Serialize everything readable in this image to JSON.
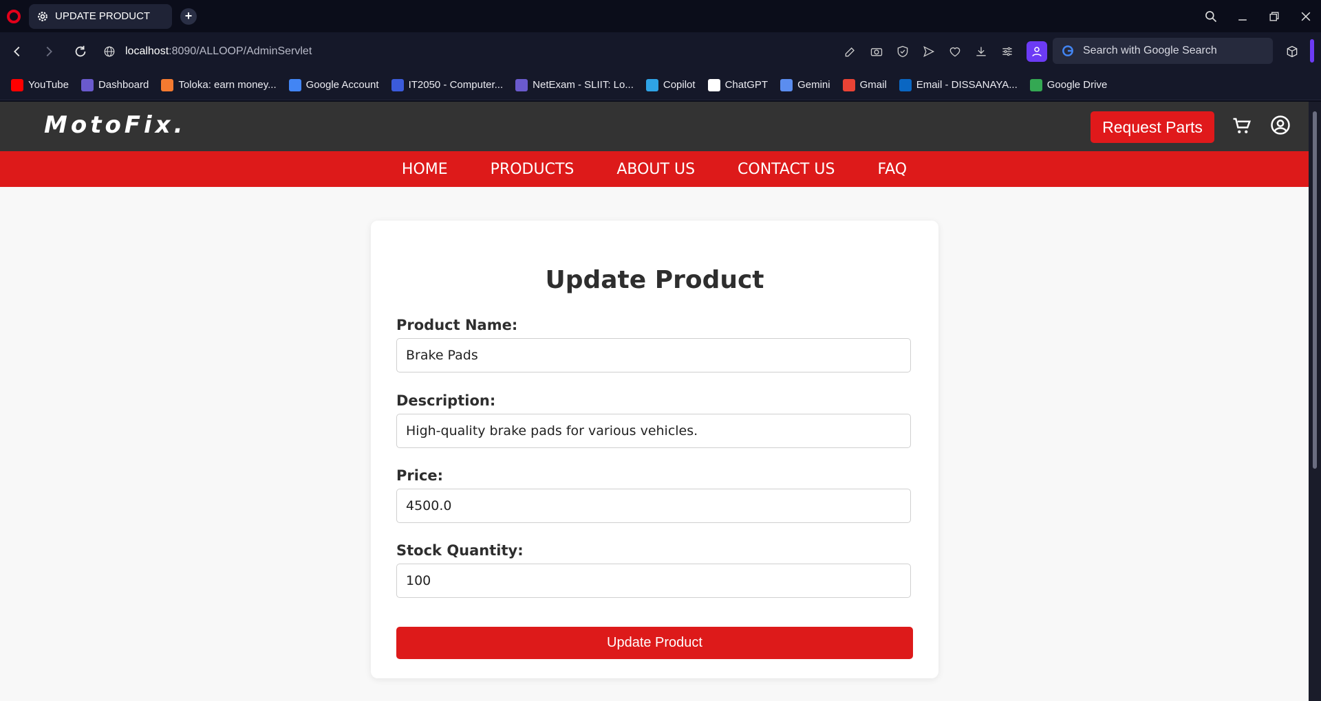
{
  "browser": {
    "tab_title": "UPDATE PRODUCT",
    "url_host": "localhost",
    "url_path": ":8090/ALLOOP/AdminServlet",
    "search_placeholder": "Search with Google Search",
    "bookmarks": [
      {
        "label": "YouTube",
        "color": "#ff0000"
      },
      {
        "label": "Dashboard",
        "color": "#6a5acd"
      },
      {
        "label": "Toloka: earn money...",
        "color": "#f47a30"
      },
      {
        "label": "Google Account",
        "color": "#4285f4"
      },
      {
        "label": "IT2050 - Computer...",
        "color": "#3b5bdb"
      },
      {
        "label": "NetExam - SLIIT: Lo...",
        "color": "#6a5acd"
      },
      {
        "label": "Copilot",
        "color": "#2fa3e6"
      },
      {
        "label": "ChatGPT",
        "color": "#ffffff"
      },
      {
        "label": "Gemini",
        "color": "#5b8def"
      },
      {
        "label": "Gmail",
        "color": "#ea4335"
      },
      {
        "label": "Email - DISSANAYA...",
        "color": "#0a66c2"
      },
      {
        "label": "Google Drive",
        "color": "#34a853"
      }
    ]
  },
  "site": {
    "logo": "MotoFix.",
    "request_parts": "Request Parts",
    "nav": [
      "HOME",
      "PRODUCTS",
      "ABOUT US",
      "CONTACT US",
      "FAQ"
    ],
    "colors": {
      "header": "#333333",
      "accent": "#dd1a1a"
    }
  },
  "form": {
    "title": "Update Product",
    "fields": [
      {
        "label": "Product Name:",
        "value": "Brake Pads"
      },
      {
        "label": "Description:",
        "value": "High-quality brake pads for various vehicles."
      },
      {
        "label": "Price:",
        "value": "4500.0"
      },
      {
        "label": "Stock Quantity:",
        "value": "100"
      }
    ],
    "submit_label": "Update Product"
  }
}
